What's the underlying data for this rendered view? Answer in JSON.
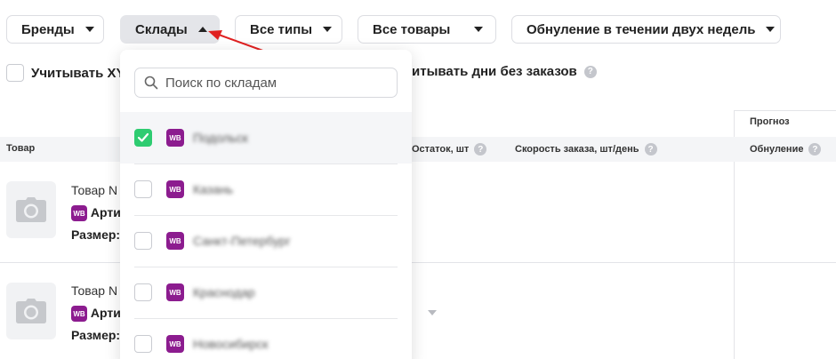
{
  "filters": {
    "brands": "Бренды",
    "warehouses": "Склады",
    "types": "Все типы",
    "products": "Все товары",
    "zeroing": "Обнуление в течении двух недель"
  },
  "options_row": {
    "consider_prefix": "Учитывать XY",
    "days_without_orders": "итывать дни без заказов"
  },
  "table": {
    "group_forecast": "Прогноз",
    "col_product": "Товар",
    "col_stock": "Остаток, шт",
    "col_order_speed": "Скорость заказа, шт/день",
    "col_zeroing": "Обнуление"
  },
  "rows": [
    {
      "name": "Товар N",
      "article": "Арти",
      "size": "Размер:"
    },
    {
      "name": "Товар N",
      "article": "Арти",
      "size": "Размер:"
    }
  ],
  "dropdown": {
    "search_placeholder": "Поиск по складам",
    "badge": "WB",
    "options": [
      {
        "name": "Подольск",
        "checked": true
      },
      {
        "name": "Казань",
        "checked": false
      },
      {
        "name": "Санкт-Петербург",
        "checked": false
      },
      {
        "name": "Краснодар",
        "checked": false
      },
      {
        "name": "Новосибирск",
        "checked": false
      }
    ]
  },
  "colors": {
    "accent_green": "#2ecc71",
    "wb_purple": "#8c1c8f",
    "annotation_red": "#e02020"
  }
}
